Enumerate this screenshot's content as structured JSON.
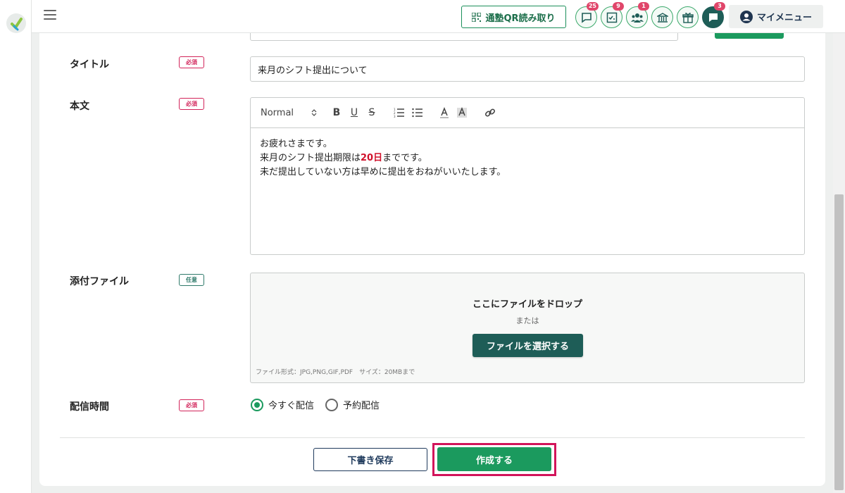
{
  "header": {
    "qr_button": "通塾QR読み取り",
    "icons": [
      {
        "name": "chat-icon",
        "badge": "25"
      },
      {
        "name": "checklist-icon",
        "badge": "9"
      },
      {
        "name": "group-icon",
        "badge": "1"
      },
      {
        "name": "school-icon",
        "badge": ""
      },
      {
        "name": "gift-icon",
        "badge": ""
      },
      {
        "name": "message-icon",
        "badge": "3"
      }
    ],
    "my_menu": "マイメニュー"
  },
  "form": {
    "title": {
      "label": "タイトル",
      "tag": "必須",
      "value": "来月のシフト提出について"
    },
    "body": {
      "label": "本文",
      "tag": "必須",
      "format_select": "Normal",
      "line1": "お疲れさまです。",
      "line2_pre": "来月のシフト提出期限は",
      "line2_highlight": "20日",
      "line2_post": "までです。",
      "line3": "未だ提出していない方は早めに提出をおねがいいたします。"
    },
    "attachment": {
      "label": "添付ファイル",
      "tag": "任意",
      "drop_text": "ここにファイルをドロップ",
      "or_text": "または",
      "select_button": "ファイルを選択する",
      "note": "ファイル形式：JPG,PNG,GIF,PDF　サイズ：20MBまで"
    },
    "delivery": {
      "label": "配信時間",
      "tag": "必須",
      "options": [
        "今すぐ配信",
        "予約配信"
      ],
      "selected": "今すぐ配信"
    }
  },
  "actions": {
    "draft": "下書き保存",
    "create": "作成する"
  },
  "colors": {
    "brand_green": "#1b9a5e",
    "dark_teal": "#1e5d57",
    "required_red": "#d2245a",
    "highlight_red": "#d0102a"
  }
}
